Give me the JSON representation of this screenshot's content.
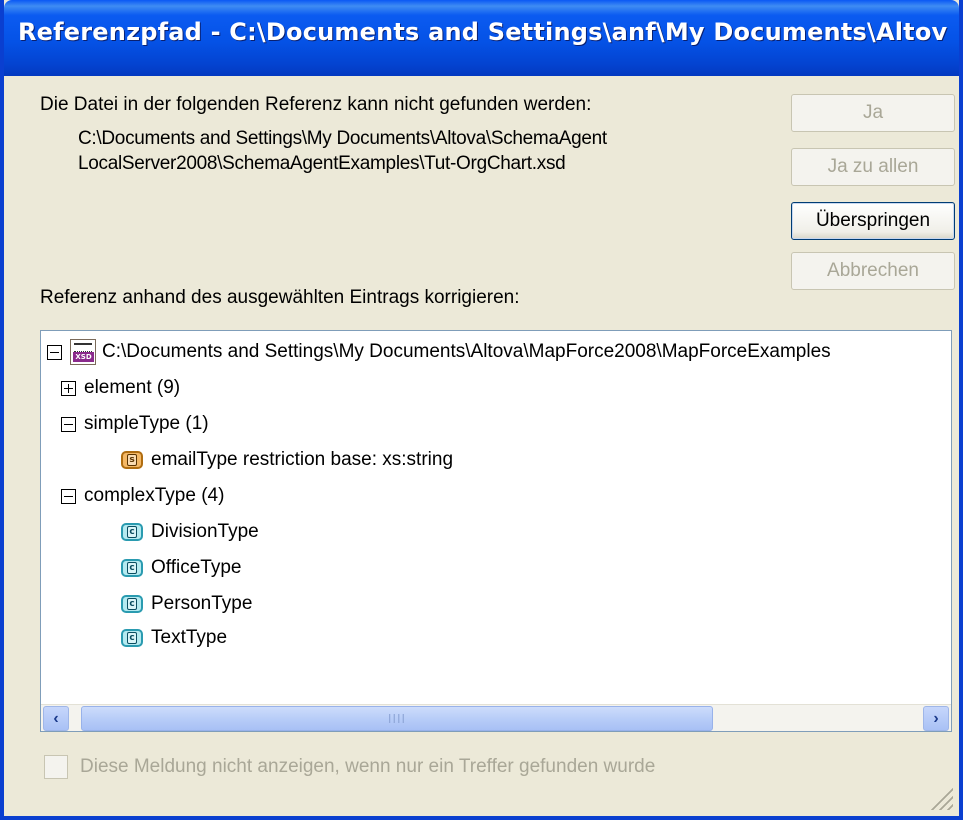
{
  "window": {
    "title": "Referenzpfad - C:\\Documents and Settings\\anf\\My Documents\\Altova\\Sch..."
  },
  "message": {
    "text": "Die Datei in der folgenden Referenz kann nicht gefunden werden:",
    "path_line1": "C:\\Documents and Settings\\My Documents\\Altova\\SchemaAgent",
    "path_line2": "LocalServer2008\\SchemaAgentExamples\\Tut-OrgChart.xsd"
  },
  "buttons": {
    "yes": "Ja",
    "yes_all": "Ja zu allen",
    "skip": "Überspringen",
    "cancel": "Abbrechen"
  },
  "correct_label": "Referenz anhand des ausgewählten Eintrags korrigieren:",
  "tree": {
    "root": "C:\\Documents and Settings\\My Documents\\Altova\\MapForce2008\\MapForceExamples",
    "root_icon": "xsd-file-icon",
    "groups": [
      {
        "label": "element (9)",
        "expanded": false,
        "items": []
      },
      {
        "label": "simpleType (1)",
        "expanded": true,
        "items": [
          {
            "label": "emailType  restriction base: xs:string",
            "kind": "simple"
          }
        ]
      },
      {
        "label": "complexType (4)",
        "expanded": true,
        "items": [
          {
            "label": "DivisionType",
            "kind": "complex"
          },
          {
            "label": "OfficeType",
            "kind": "complex"
          },
          {
            "label": "PersonType",
            "kind": "complex"
          },
          {
            "label": "TextType",
            "kind": "complex"
          }
        ]
      }
    ],
    "icon_letters": {
      "simple": "s",
      "complex": "c"
    }
  },
  "checkbox": {
    "label": "Diese Meldung nicht anzeigen, wenn nur ein Treffer gefunden wurde",
    "checked": false,
    "enabled": false
  },
  "scrollbar": {
    "grip": "IIII"
  }
}
